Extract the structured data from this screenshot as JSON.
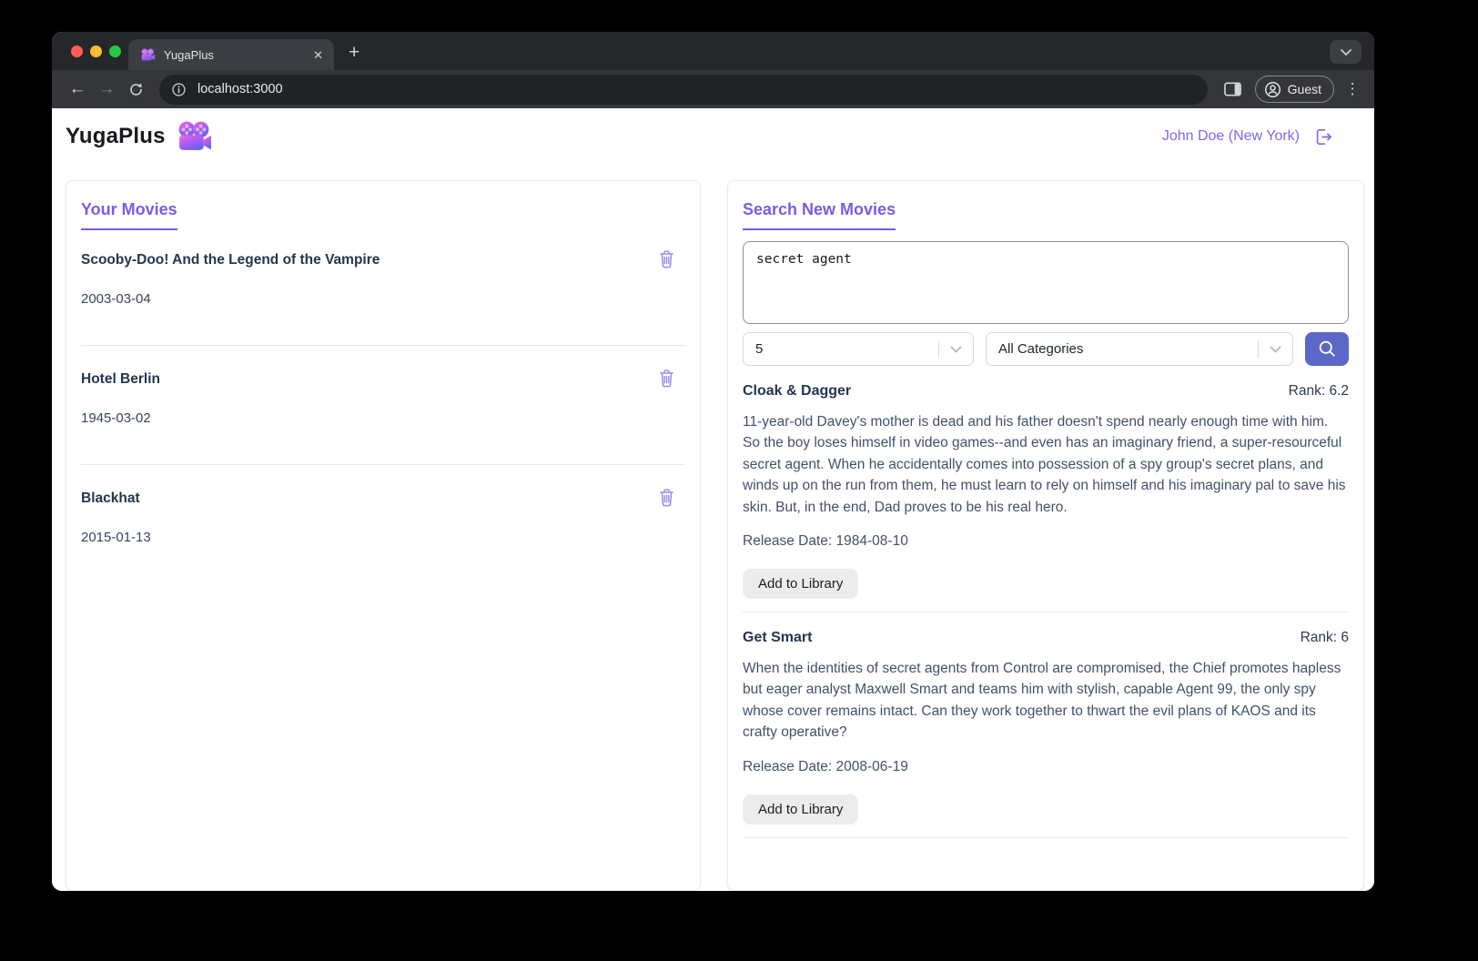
{
  "browser": {
    "tab_title": "YugaPlus",
    "close_glyph": "✕",
    "new_tab_glyph": "+",
    "back_glyph": "←",
    "forward_glyph": "→",
    "url": "localhost:3000",
    "guest_label": "Guest",
    "menu_glyph": "⋮"
  },
  "header": {
    "app_title": "YugaPlus",
    "user": "John Doe (New York)"
  },
  "library": {
    "heading": "Your Movies",
    "movies": [
      {
        "title": "Scooby-Doo! And the Legend of the Vampire",
        "date": "2003-03-04"
      },
      {
        "title": "Hotel Berlin",
        "date": "1945-03-02"
      },
      {
        "title": "Blackhat",
        "date": "2015-01-13"
      }
    ]
  },
  "search": {
    "heading": "Search New Movies",
    "query": "secret agent",
    "results_limit": "5",
    "category": "All Categories",
    "results": [
      {
        "title": "Cloak & Dagger",
        "rank": "Rank: 6.2",
        "description": "11-year-old Davey's mother is dead and his father doesn't spend nearly enough time with him. So the boy loses himself in video games--and even has an imaginary friend, a super-resourceful secret agent. When he accidentally comes into possession of a spy group's secret plans, and winds up on the run from them, he must learn to rely on himself and his imaginary pal to save his skin. But, in the end, Dad proves to be his real hero.",
        "release": "Release Date: 1984-08-10",
        "add_label": "Add to Library"
      },
      {
        "title": "Get Smart",
        "rank": "Rank: 6",
        "description": "When the identities of secret agents from Control are compromised, the Chief promotes hapless but eager analyst Maxwell Smart and teams him with stylish, capable Agent 99, the only spy whose cover remains intact. Can they work together to thwart the evil plans of KAOS and its crafty operative?",
        "release": "Release Date: 2008-06-19",
        "add_label": "Add to Library"
      }
    ]
  },
  "colors": {
    "accent_purple": "#7a5be8",
    "user_purple": "#7b68ee",
    "trash_purple": "#968fea",
    "search_button_indigo": "#5b68c8",
    "title_navy": "#253550",
    "body_slate": "#41516b"
  }
}
